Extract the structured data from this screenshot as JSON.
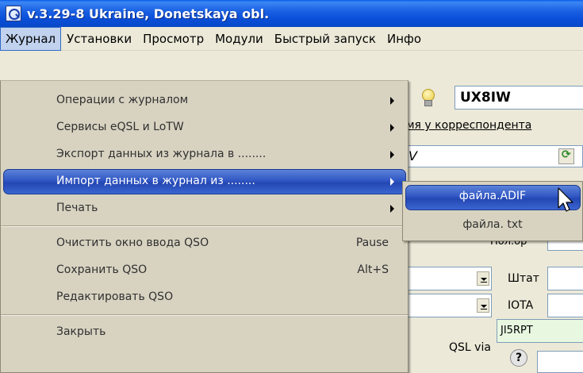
{
  "window": {
    "title": "v.3.29-8 Ukraine, Donetskaya obl."
  },
  "menubar": {
    "items": [
      "Журнал",
      "Установки",
      "Просмотр",
      "Модули",
      "Быстрый запуск",
      "Инфо"
    ]
  },
  "journal_menu": {
    "items": [
      {
        "label": "Операции с журналом",
        "has_submenu": true
      },
      {
        "label": "Сервисы eQSL и LoTW",
        "has_submenu": true
      },
      {
        "label": "Экспорт данных из журнала в ........",
        "has_submenu": true
      },
      {
        "label": "Импорт данных в журнал из ........",
        "has_submenu": true,
        "highlighted": true
      },
      {
        "label": "Печать",
        "has_submenu": true
      },
      {
        "label": "Очистить окно ввода QSO",
        "shortcut": "Pause"
      },
      {
        "label": "Сохранить QSO",
        "shortcut": "Alt+S"
      },
      {
        "label": "Редактировать QSO"
      },
      {
        "label": "Закрыть"
      }
    ]
  },
  "import_submenu": {
    "items": [
      {
        "label": "файла.ADIF",
        "highlighted": true
      },
      {
        "label": "файла. txt"
      }
    ]
  },
  "form": {
    "callsign": "UX8IW",
    "correspondent_label_partial": "мя у корреспондента",
    "v_field_value": "V",
    "partial_label": "Пол.ор",
    "state_label": "Штат",
    "iota_label": "IOTA",
    "qsl_via_label": "QSL via",
    "qsl_via_value": "JI5RPT",
    "help_symbol": "?"
  },
  "colors": {
    "titlebar": "#0a4fd9",
    "menu_highlight": "#3157c4",
    "menu_bg": "#d8d3c1",
    "qsl_field_bg": "#e8f8e0"
  }
}
